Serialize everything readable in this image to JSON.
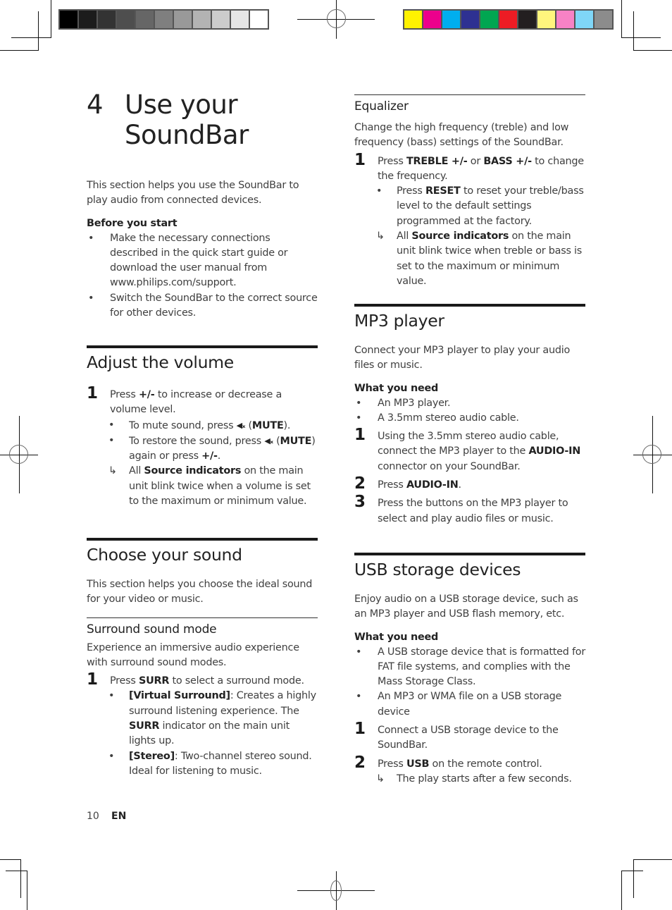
{
  "print_marks": {
    "grayscale_swatches": [
      "#000000",
      "#1c1c1c",
      "#333333",
      "#4e4e4e",
      "#666666",
      "#7f7f7f",
      "#999999",
      "#b3b3b3",
      "#cccccc",
      "#e6e6e6",
      "#ffffff"
    ],
    "color_swatches": [
      "#fff200",
      "#ec008c",
      "#00aeef",
      "#2e3192",
      "#00a651",
      "#ed1c24",
      "#231f20",
      "#fff57d",
      "#f782c5",
      "#7fd6f7",
      "#8c8c8c"
    ]
  },
  "chapter": {
    "number": "4",
    "title": "Use your SoundBar"
  },
  "intro": {
    "text": "This section helps you use the SoundBar to play audio from connected devices.",
    "before_label": "Before you start",
    "bullets": [
      "Make the necessary connections described in the quick start guide or download the user manual from www.philips.com/support.",
      "Switch the SoundBar to the correct source for other devices."
    ]
  },
  "adjust_volume": {
    "heading": "Adjust the volume",
    "step_num": "1",
    "step_pre": "Press ",
    "step_key": "+/-",
    "step_post": " to increase or decrease a volume level.",
    "sub1_pre": "To mute sound, press ",
    "sub1_open": " (",
    "sub1_key": "MUTE",
    "sub1_post": ").",
    "sub2_pre": "To restore the sound, press ",
    "sub2_open": " (",
    "sub2_key": "MUTE",
    "sub2_mid": ") again or press ",
    "sub2_key2": "+/-",
    "sub2_post": ".",
    "result_pre": "All ",
    "result_key": "Source indicators",
    "result_post": " on the main unit blink twice when a volume is set to the maximum or minimum value."
  },
  "choose_sound": {
    "heading": "Choose your sound",
    "text": "This section helps you choose the ideal sound for your video or music.",
    "surround": {
      "heading": "Surround sound mode",
      "text": "Experience an immersive audio experience with surround sound modes.",
      "step_num": "1",
      "step_pre": "Press ",
      "step_key": "SURR",
      "step_post": " to select a surround mode.",
      "opt1_key": "[Virtual Surround]",
      "opt1_mid": ": Creates a highly surround listening experience. The ",
      "opt1_key2": "SURR",
      "opt1_post": " indicator on the main unit lights up.",
      "opt2_key": "[Stereo]",
      "opt2_post": ": Two-channel stereo sound. Ideal for listening to music."
    }
  },
  "equalizer": {
    "heading": "Equalizer",
    "text": "Change the high frequency (treble) and low frequency (bass) settings of the SoundBar.",
    "step_num": "1",
    "step_pre": "Press ",
    "step_key1": "TREBLE +/-",
    "step_mid": " or ",
    "step_key2": "BASS +/-",
    "step_post": " to change the frequency.",
    "sub_pre": "Press ",
    "sub_key": "RESET",
    "sub_post": " to reset your treble/bass level to the default settings programmed at the factory.",
    "result_pre": "All ",
    "result_key": "Source indicators",
    "result_post": " on the main unit blink twice when treble or bass is set to the maximum or minimum value."
  },
  "mp3": {
    "heading": "MP3 player",
    "text": "Connect your MP3 player to play your audio files or music.",
    "need_label": "What you need",
    "needs": [
      "An MP3 player.",
      "A 3.5mm stereo audio cable."
    ],
    "step1_num": "1",
    "step1_pre": "Using the 3.5mm stereo audio cable, connect the MP3 player to the ",
    "step1_key": "AUDIO-IN",
    "step1_post": " connector on your SoundBar.",
    "step2_num": "2",
    "step2_pre": "Press ",
    "step2_key": "AUDIO-IN",
    "step2_post": ".",
    "step3_num": "3",
    "step3_text": "Press the buttons on the MP3 player to select and play audio files or music."
  },
  "usb": {
    "heading": "USB storage devices",
    "text": "Enjoy audio on a USB storage device, such as an MP3 player and USB flash memory, etc.",
    "need_label": "What you need",
    "needs": [
      "A USB storage device that is formatted for FAT file systems, and complies with the Mass Storage Class.",
      "An MP3 or WMA file on a USB storage device"
    ],
    "step1_num": "1",
    "step1_text": "Connect a USB storage device to the SoundBar.",
    "step2_num": "2",
    "step2_pre": "Press ",
    "step2_key": "USB",
    "step2_post": " on the remote control.",
    "result_text": "The play starts after a few seconds."
  },
  "glyphs": {
    "mute_icon": "◀ₓ",
    "result_arrow": "↳"
  },
  "footer": {
    "page_number": "10",
    "language": "EN"
  }
}
